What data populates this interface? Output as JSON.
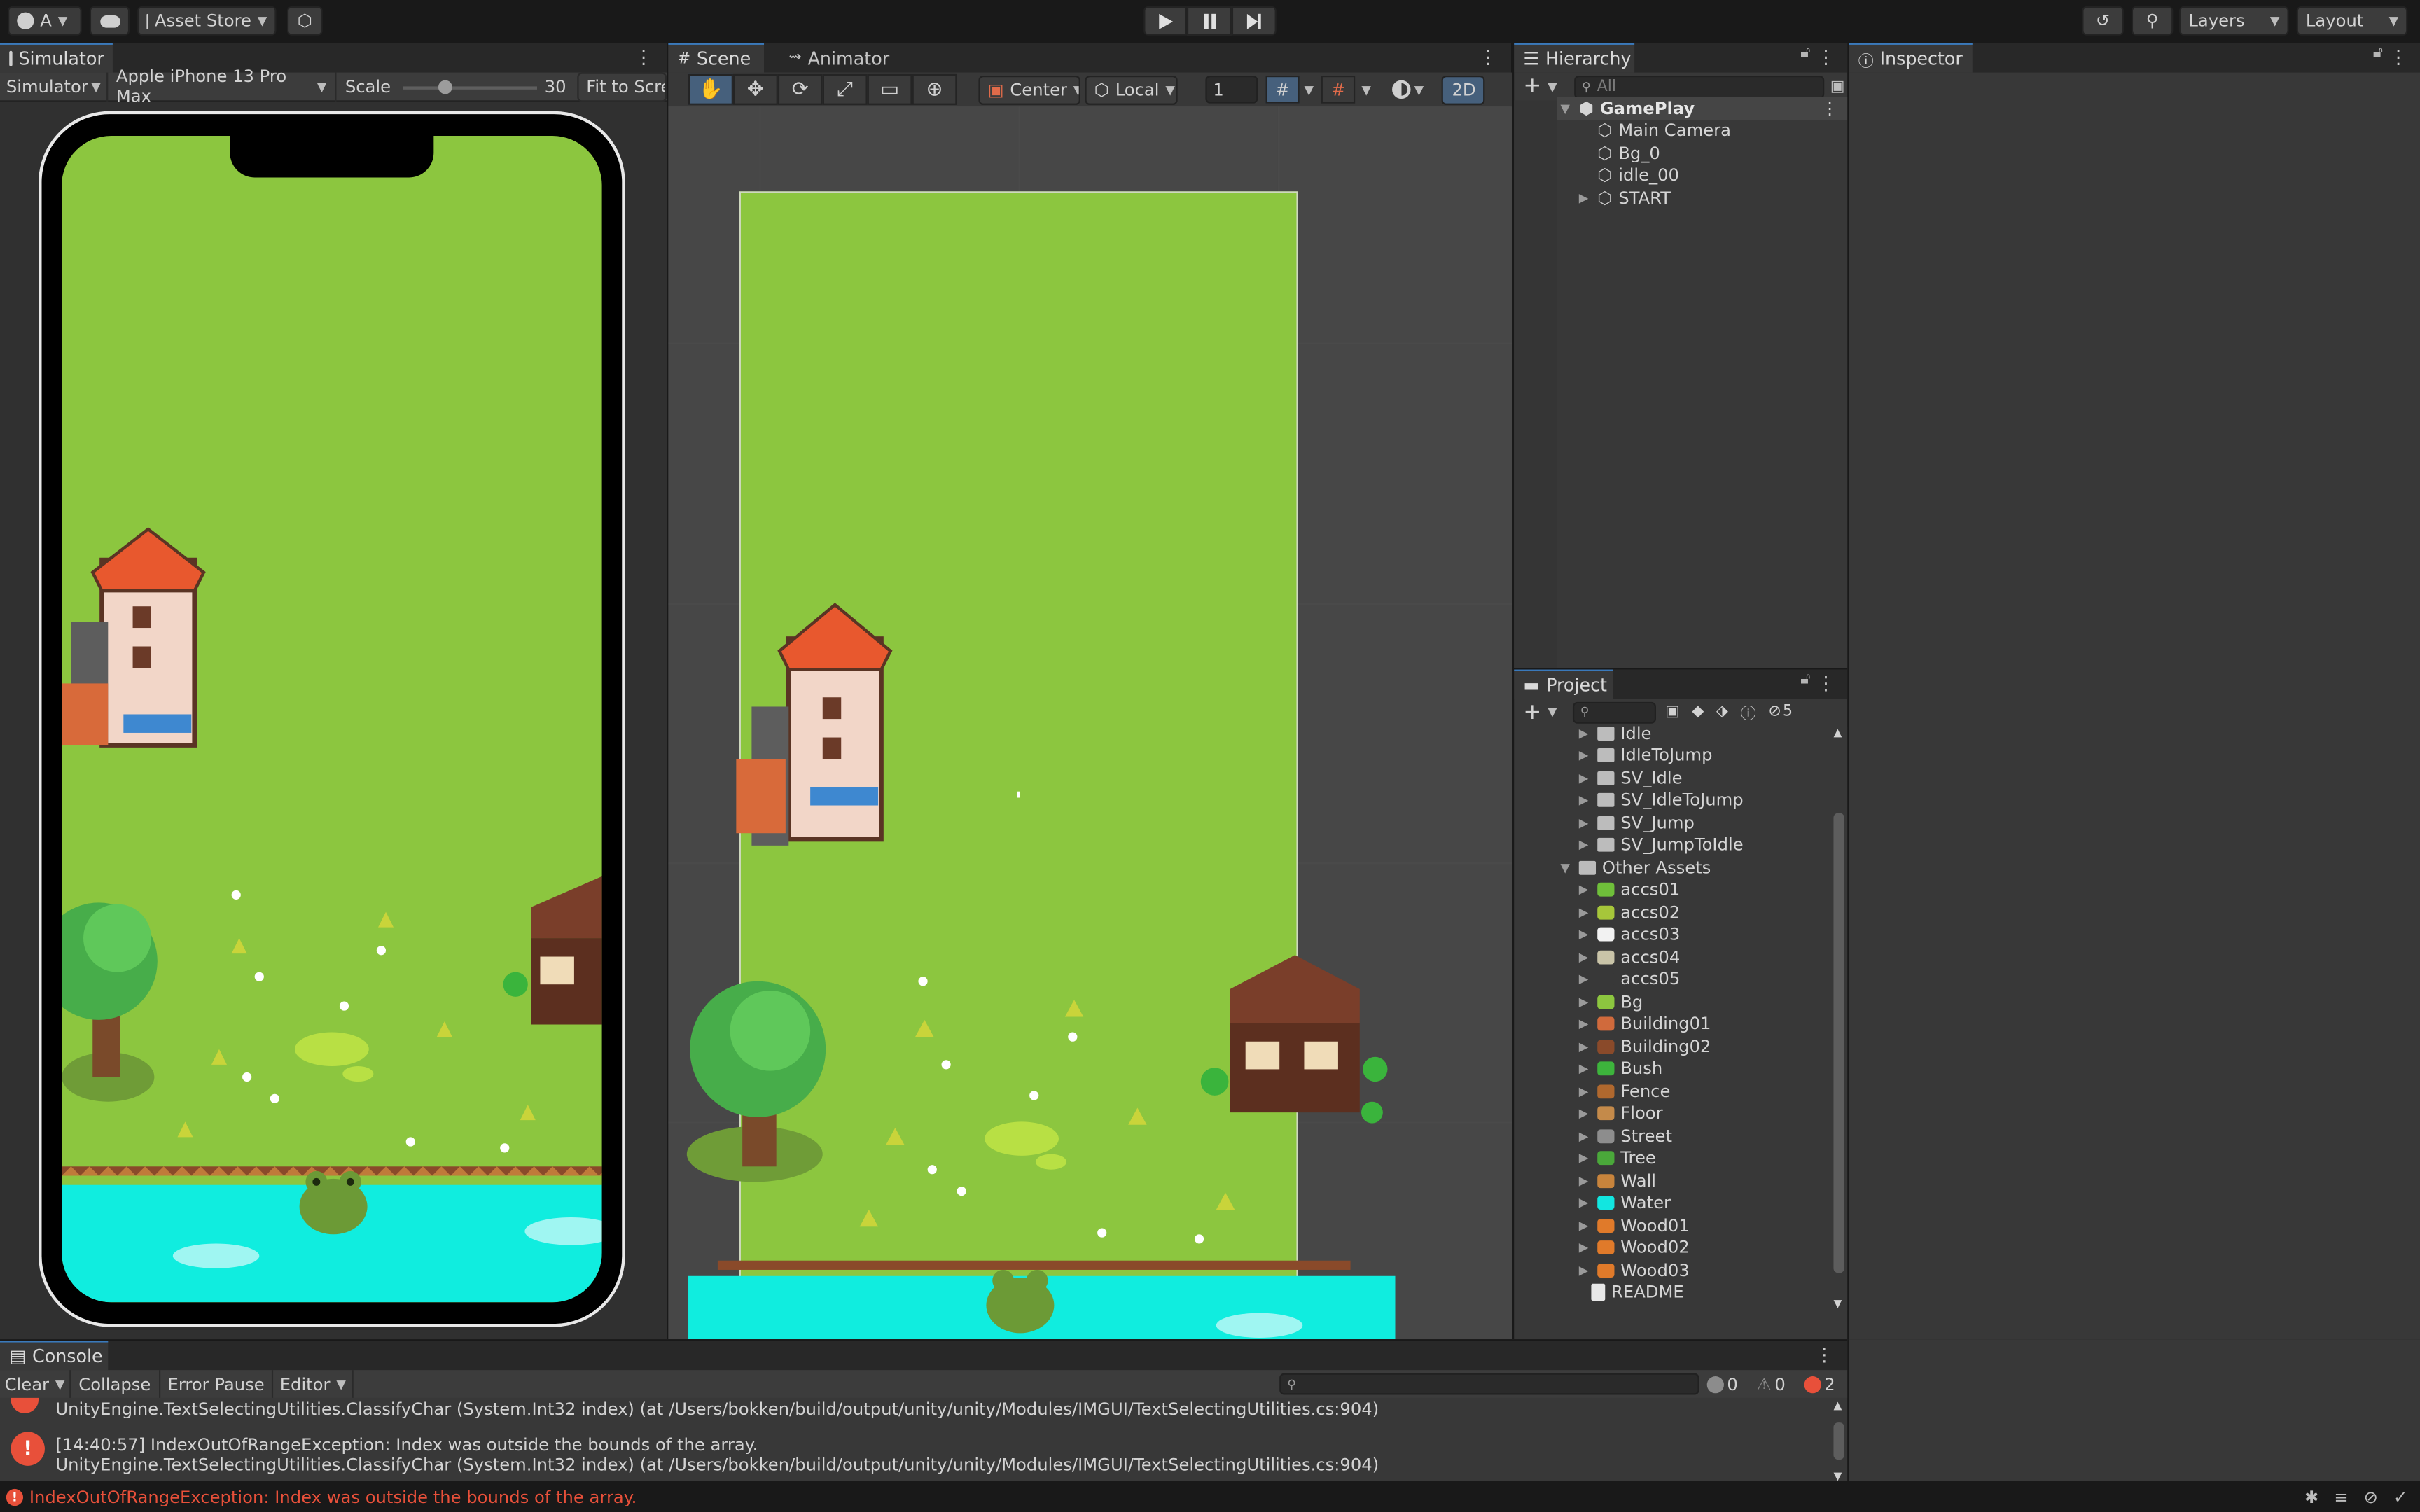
{
  "toolbar": {
    "account": "A",
    "asset_store": "Asset Store",
    "layers": "Layers",
    "layout": "Layout"
  },
  "simulator": {
    "tab": "Simulator",
    "mode": "Simulator",
    "device": "Apple iPhone 13 Pro Max",
    "scale_label": "Scale",
    "scale_value": "30",
    "scale_fraction": 0.25,
    "fit": "Fit to Screen"
  },
  "scene": {
    "tab_scene": "Scene",
    "tab_animator": "Animator",
    "pivot": "Center",
    "space": "Local",
    "snap_value": "1",
    "mode_2d": "2D"
  },
  "hierarchy": {
    "tab": "Hierarchy",
    "search_placeholder": "All",
    "root": "GamePlay",
    "items": [
      "Main Camera",
      "Bg_0",
      "idle_00",
      "START"
    ]
  },
  "inspector": {
    "tab": "Inspector"
  },
  "project": {
    "tab": "Project",
    "hidden_count": "5",
    "anim_folders": [
      "Idle",
      "IdleToJump",
      "SV_Idle",
      "SV_IdleToJump",
      "SV_Jump",
      "SV_JumpToIdle"
    ],
    "other_assets": "Other Assets",
    "assets": [
      {
        "name": "accs01",
        "color": "#6fbf3a"
      },
      {
        "name": "accs02",
        "color": "#a6c63a"
      },
      {
        "name": "accs03",
        "color": "#f2f2f2"
      },
      {
        "name": "accs04",
        "color": "#c9c4a8"
      },
      {
        "name": "accs05",
        "color": "#383838"
      },
      {
        "name": "Bg",
        "color": "#8cc63f"
      },
      {
        "name": "Building01",
        "color": "#d06a3c"
      },
      {
        "name": "Building02",
        "color": "#8a4a2a"
      },
      {
        "name": "Bush",
        "color": "#3db43c"
      },
      {
        "name": "Fence",
        "color": "#b0682e"
      },
      {
        "name": "Floor",
        "color": "#c48a4a"
      },
      {
        "name": "Street",
        "color": "#8d8d8d"
      },
      {
        "name": "Tree",
        "color": "#4aa83a"
      },
      {
        "name": "Wall",
        "color": "#c8843c"
      },
      {
        "name": "Water",
        "color": "#12e6e0"
      },
      {
        "name": "Wood01",
        "color": "#e07a2a"
      },
      {
        "name": "Wood02",
        "color": "#e07a2a"
      },
      {
        "name": "Wood03",
        "color": "#e07a2a"
      }
    ],
    "readme": "README"
  },
  "console": {
    "tab": "Console",
    "clear": "Clear",
    "collapse": "Collapse",
    "error_pause": "Error Pause",
    "editor": "Editor",
    "count_log": "0",
    "count_warn": "0",
    "count_error": "2",
    "line_top": "UnityEngine.TextSelectingUtilities.ClassifyChar (System.Int32 index) (at /Users/bokken/build/output/unity/unity/Modules/IMGUI/TextSelectingUtilities.cs:904)",
    "entry_line1": "[14:40:57] IndexOutOfRangeException: Index was outside the bounds of the array.",
    "entry_line2": "UnityEngine.TextSelectingUtilities.ClassifyChar (System.Int32 index) (at /Users/bokken/build/output/unity/unity/Modules/IMGUI/TextSelectingUtilities.cs:904)"
  },
  "status": {
    "error": "IndexOutOfRangeException: Index was outside the bounds of the array."
  },
  "colors": {
    "grass": "#8cc63f",
    "water": "#10eddf",
    "accent": "#3a79bb",
    "error": "#e8503a"
  }
}
